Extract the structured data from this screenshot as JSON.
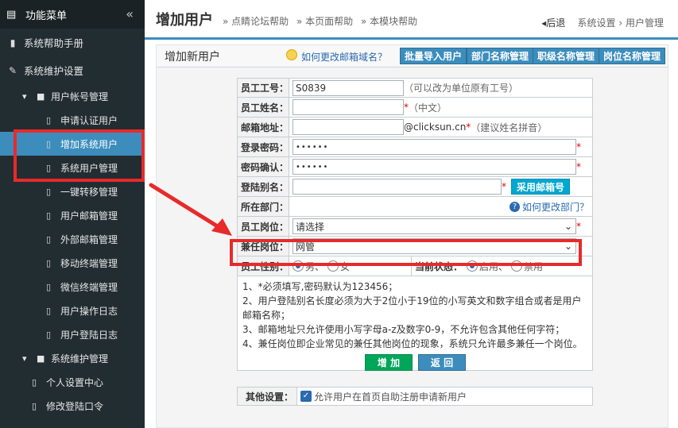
{
  "sidebar": {
    "header": "功能菜单",
    "collapse_glyph": "«",
    "items": [
      {
        "label": "系统帮助手册",
        "icon": "book-icon"
      },
      {
        "label": "系统维护设置",
        "icon": "wrench-icon"
      }
    ],
    "group1": {
      "label": "用户帐号管理"
    },
    "group1_items": [
      {
        "label": "申请认证用户"
      },
      {
        "label": "增加系统用户"
      },
      {
        "label": "系统用户管理"
      },
      {
        "label": "一键转移管理"
      },
      {
        "label": "用户邮箱管理"
      },
      {
        "label": "外部邮箱管理"
      },
      {
        "label": "移动终端管理"
      },
      {
        "label": "微信终端管理"
      },
      {
        "label": "用户操作日志"
      },
      {
        "label": "用户登陆日志"
      }
    ],
    "group2": {
      "label": "系统维护管理"
    },
    "group2_items": [
      {
        "label": "个人设置中心"
      },
      {
        "label": "修改登陆口令"
      }
    ]
  },
  "header": {
    "title": "增加用户",
    "links": [
      "» 点睛论坛帮助",
      "» 本页面帮助",
      "» 本模块帮助"
    ],
    "back": "后退",
    "crumb1": "系统设置",
    "crumb_sep": "›",
    "crumb2": "用户管理"
  },
  "panel": {
    "title": "增加新用户",
    "help_link": "如何更改邮箱域名？",
    "buttons": [
      "批量导入用户",
      "部门名称管理",
      "职级名称管理",
      "岗位名称管理"
    ]
  },
  "form": {
    "emp_id": {
      "label": "员工工号：",
      "value": "S0839",
      "hint": "（可以改为单位原有工号）"
    },
    "emp_name": {
      "label": "员工姓名：",
      "value": "",
      "hint": "（中文）"
    },
    "email": {
      "label": "邮箱地址：",
      "value": "",
      "domain": "@clicksun.cn",
      "hint": "（建议姓名拼音）"
    },
    "password": {
      "label": "登录密码：",
      "value": "••••••"
    },
    "password_confirm": {
      "label": "密码确认：",
      "value": "••••••"
    },
    "alias": {
      "label": "登陆别名：",
      "value": "",
      "button": "采用邮箱号"
    },
    "department": {
      "label": "所在部门：",
      "help": "如何更改部门？"
    },
    "position": {
      "label": "员工岗位：",
      "value": "请选择"
    },
    "concurrent_position": {
      "label": "兼任岗位：",
      "value": "网管"
    },
    "gender": {
      "label": "员工性别：",
      "options": [
        "男",
        "女"
      ],
      "selected": "男"
    },
    "status": {
      "label": "当前状态：",
      "options": [
        "启用",
        "禁用"
      ],
      "selected": "启用"
    },
    "notes": [
      "1、*必须填写,密码默认为123456；",
      "2、用户登陆别名长度必须为大于2位小于19位的小写英文和数字组合或者是用户邮箱名称；",
      "3、邮箱地址只允许使用小写字母a-z及数字0-9，不允许包含其他任何字符；",
      "4、兼任岗位即企业常见的兼任其他岗位的现象，系统只允许最多兼任一个岗位。"
    ],
    "add_button": "增 加",
    "back_button": "返 回"
  },
  "other": {
    "label": "其他设置：",
    "checkbox_label": "允许用户在首页自助注册申请新用户",
    "checked": true
  },
  "colors": {
    "sidebar_bg": "#222d32",
    "active": "#3c8dbc",
    "annotation": "#e82a2a",
    "add_btn": "#00a65a",
    "back_btn": "#3c8dbc"
  }
}
